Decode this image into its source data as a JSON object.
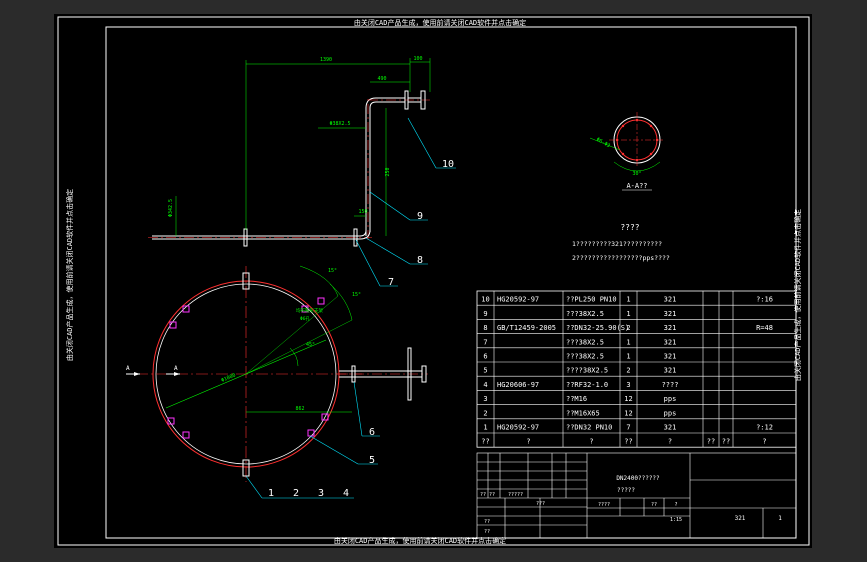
{
  "colors": {
    "app_bg": "#2b2b2b",
    "canvas_bg": "#000000",
    "frame": "#ffffff",
    "pipe_red": "#ff3030",
    "dimension_green": "#00ff00",
    "cyan": "#00e5ff",
    "purple": "#ff33ff",
    "text_white": "#ffffff"
  },
  "watermarks": {
    "top": "由关闭CAD产品生成，使用前请关闭CAD软件并点击确定",
    "bottom": "由关闭CAD产品生成，使用前请关闭CAD软件并点击确定",
    "left": "由关闭CAD产品生成，使用前请关闭CAD软件并点击确定",
    "right": "由关闭CAD产品生成，使用前请关闭CAD软件并点击确定"
  },
  "elevation_dims": {
    "len_top": "1390",
    "len_top2": "100",
    "len_side": "490",
    "dia_label": "Φ38X2.5",
    "left_dim": "Φ342.5",
    "small_dim": "150",
    "vert_dim": "250"
  },
  "section": {
    "label": "A-A??",
    "dim_angle": "30°",
    "dim_dia": "Φ6-Φ3"
  },
  "plan_dims": {
    "a_left": "A",
    "a_right": "A",
    "ang1": "15°",
    "ang2": "15°",
    "ang3": "45°",
    "dia": "Φ1000",
    "offset": "862",
    "hole_note1": "均布鞍形支架",
    "hole_note2": "Φ6孔"
  },
  "callouts": [
    "1",
    "2",
    "3",
    "4",
    "5",
    "6",
    "7",
    "8",
    "9",
    "10"
  ],
  "notes": {
    "title": "????",
    "line1": "1?????????321??????????",
    "line2": "2?????????????????pps????"
  },
  "bom": [
    {
      "no": "10",
      "std": "HG20592-97",
      "name": "??PL250 PN10",
      "qty": "1",
      "mat": "321",
      "rem": "?:16"
    },
    {
      "no": "9",
      "std": "",
      "name": "???38X2.5",
      "qty": "1",
      "mat": "321",
      "rem": ""
    },
    {
      "no": "8",
      "std": "GB/T12459-2005",
      "name": "??DN32-25.90(S)",
      "qty": "2",
      "mat": "321",
      "rem": "R=48"
    },
    {
      "no": "7",
      "std": "",
      "name": "???38X2.5",
      "qty": "1",
      "mat": "321",
      "rem": ""
    },
    {
      "no": "6",
      "std": "",
      "name": "???38X2.5",
      "qty": "1",
      "mat": "321",
      "rem": ""
    },
    {
      "no": "5",
      "std": "",
      "name": "????38X2.5",
      "qty": "2",
      "mat": "321",
      "rem": ""
    },
    {
      "no": "4",
      "std": "HG20606-97",
      "name": "??RF32-1.0",
      "qty": "3",
      "mat": "????",
      "rem": ""
    },
    {
      "no": "3",
      "std": "",
      "name": "??M16",
      "qty": "12",
      "mat": "pps",
      "rem": ""
    },
    {
      "no": "2",
      "std": "",
      "name": "??M16X65",
      "qty": "12",
      "mat": "pps",
      "rem": ""
    },
    {
      "no": "1",
      "std": "HG20592-97",
      "name": "??DN32 PN10",
      "qty": "7",
      "mat": "321",
      "rem": "?:12"
    }
  ],
  "bom_header": {
    "no": "??",
    "std": "?",
    "name": "?",
    "qty": "??",
    "mat": "?",
    "w1": "??",
    "w2": "??",
    "rem": "?"
  },
  "title_block": {
    "drawing_name": "DN2400??????",
    "drawing_sub": "?????",
    "material": "321",
    "sheet": "1",
    "scale": "1:15",
    "row_a": "?? ??",
    "row_b": "?????",
    "row_c": "???",
    "row_d": "??",
    "row_e": "??",
    "c1": "????",
    "c2": "??",
    "c3": "?"
  }
}
